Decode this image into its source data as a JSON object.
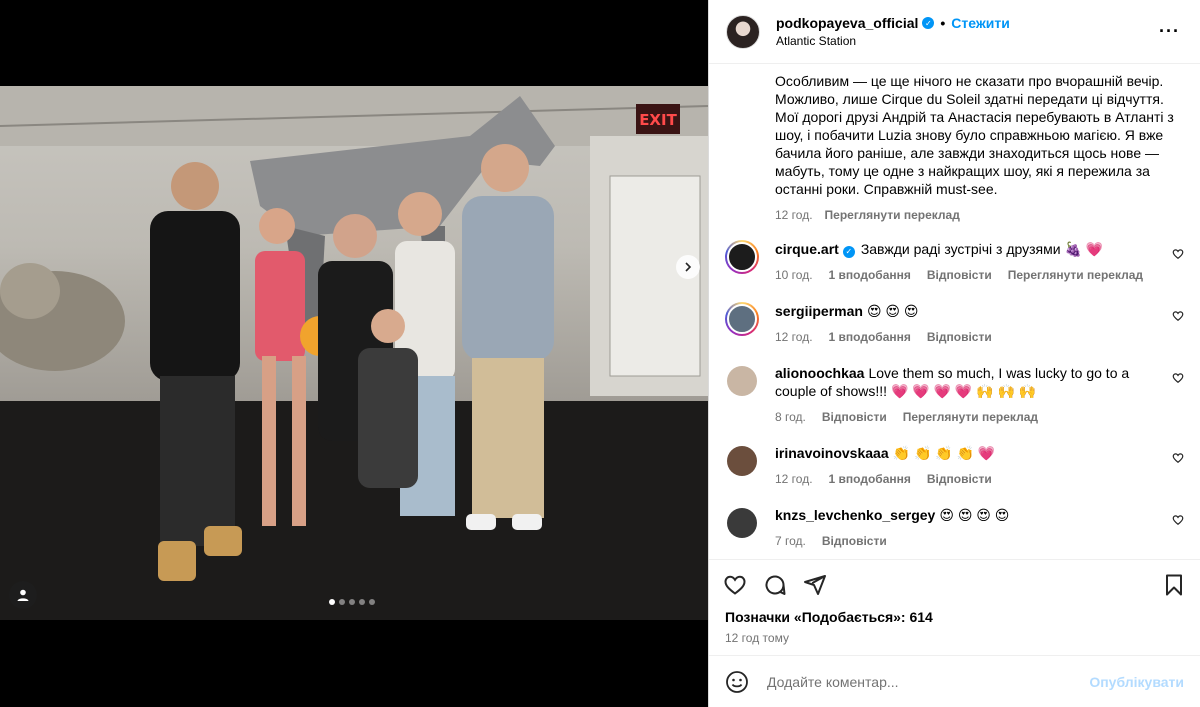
{
  "post": {
    "username": "podkopayeva_official",
    "follow_label": "Стежити",
    "separator": "•",
    "location": "Atlantic Station",
    "more_label": "···"
  },
  "caption": {
    "text": "Особливим — це ще нічого не сказати про вчорашній вечір. Можливо, лише Cirque du Soleil здатні передати ці відчуття. Мої дорогі друзі Андрій та Анастасія перебувають в Атланті з шоу, і побачити Luzia знову було справжньою магією. Я вже бачила його раніше, але завжди знаходиться щось нове — мабуть, тому це одне з найкращих шоу, які я пережила за останні роки. Справжній must-see.",
    "time": "12 год.",
    "translate": "Переглянути переклад"
  },
  "comments": [
    {
      "user": "cirque.art",
      "verified": true,
      "text": "Завжди раді зустрічі з друзями 🍇 💗",
      "time": "10 год.",
      "likes": "1 вподобання",
      "reply": "Відповісти",
      "translate": "Переглянути переклад",
      "avatar_color": "#1c1c1c",
      "ring": true
    },
    {
      "user": "sergiiperman",
      "verified": false,
      "text": "😍 😍 😍",
      "time": "12 год.",
      "likes": "1 вподобання",
      "reply": "Відповісти",
      "translate": "",
      "avatar_color": "#5e6f80",
      "ring": true
    },
    {
      "user": "alionoochkaa",
      "verified": false,
      "text": "Love them so much, I was lucky to go to a couple of shows!!! 💗 💗 💗 💗 🙌 🙌 🙌",
      "time": "8 год.",
      "likes": "",
      "reply": "Відповісти",
      "translate": "Переглянути переклад",
      "avatar_color": "#c9b6a4",
      "ring": false
    },
    {
      "user": "irinavoinovskaaa",
      "verified": false,
      "text": "👏 👏 👏 👏 💗",
      "time": "12 год.",
      "likes": "1 вподобання",
      "reply": "Відповісти",
      "translate": "",
      "avatar_color": "#6b4e3d",
      "ring": false
    },
    {
      "user": "knzs_levchenko_sergey",
      "verified": false,
      "text": "😍 😍 😍 😍",
      "time": "7 год.",
      "likes": "",
      "reply": "Відповісти",
      "translate": "",
      "avatar_color": "#3a3a3a",
      "ring": false
    }
  ],
  "footer": {
    "likes_text": "Позначки «Подобається»: 614",
    "time_ago": "12 год тому",
    "comment_placeholder": "Додайте коментар...",
    "publish_label": "Опублікувати"
  },
  "carousel": {
    "dots": 5,
    "active_dot": 1
  },
  "colors": {
    "accent": "#0095f6",
    "muted": "#737373",
    "publish_disabled": "#b3dbff"
  }
}
